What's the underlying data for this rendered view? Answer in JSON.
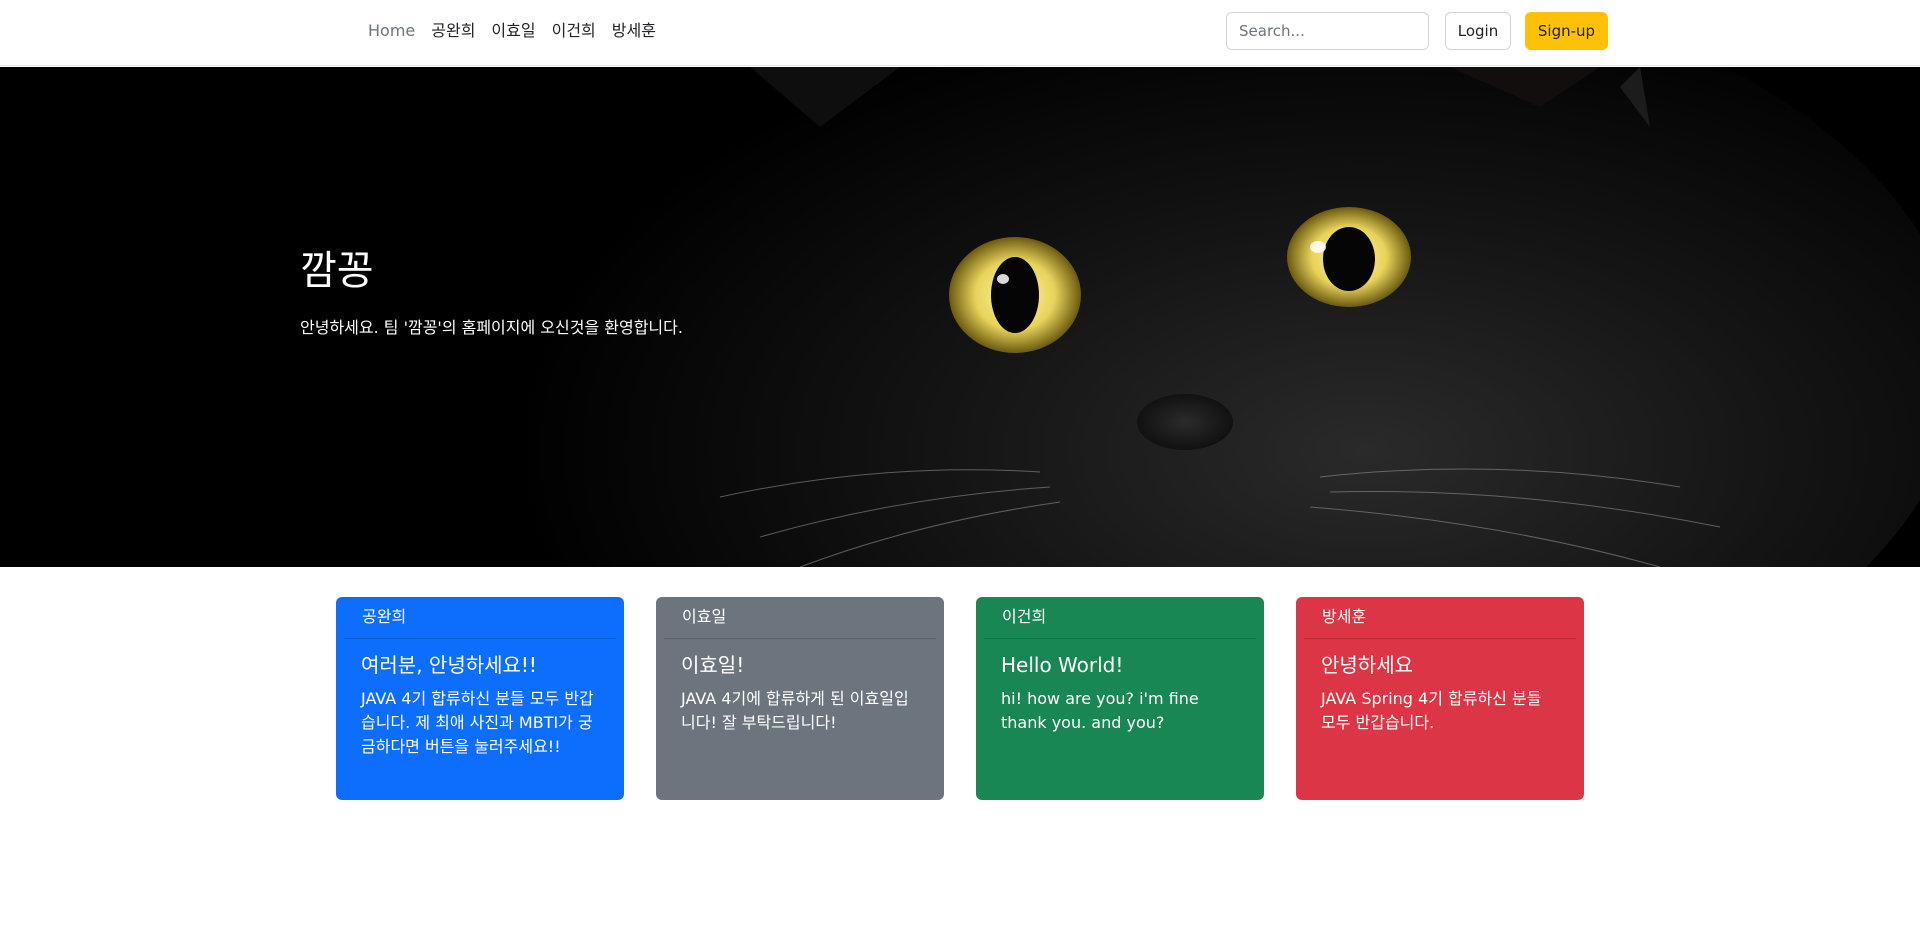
{
  "nav": {
    "links": [
      "Home",
      "공완희",
      "이효일",
      "이건희",
      "방세훈"
    ],
    "search_placeholder": "Search...",
    "login_label": "Login",
    "signup_label": "Sign-up"
  },
  "hero": {
    "title": "깜꽁",
    "subtitle": "안녕하세요. 팀 '깜꽁'의 홈페이지에 오신것을 환영합니다."
  },
  "cards": [
    {
      "header": "공완희",
      "title": "여러분, 안녕하세요!!",
      "text": "JAVA 4기 합류하신 분들 모두 반갑습니다. 제 최애 사진과 MBTI가 궁금하다면 버튼을 눌러주세요!!",
      "color": "#0d6efd"
    },
    {
      "header": "이효일",
      "title": "이효일!",
      "text": "JAVA 4기에 합류하게 된 이효일입니다! 잘 부탁드립니다!",
      "color": "#6c757d"
    },
    {
      "header": "이건희",
      "title": "Hello World!",
      "text": "hi! how are you? i'm fine thank you. and you?",
      "color": "#198754"
    },
    {
      "header": "방세훈",
      "title": "안녕하세요",
      "text": "JAVA Spring 4기 합류하신 분들 모두 반갑습니다.",
      "color": "#dc3545"
    }
  ],
  "colors": {
    "accent_warning": "#ffc107"
  }
}
